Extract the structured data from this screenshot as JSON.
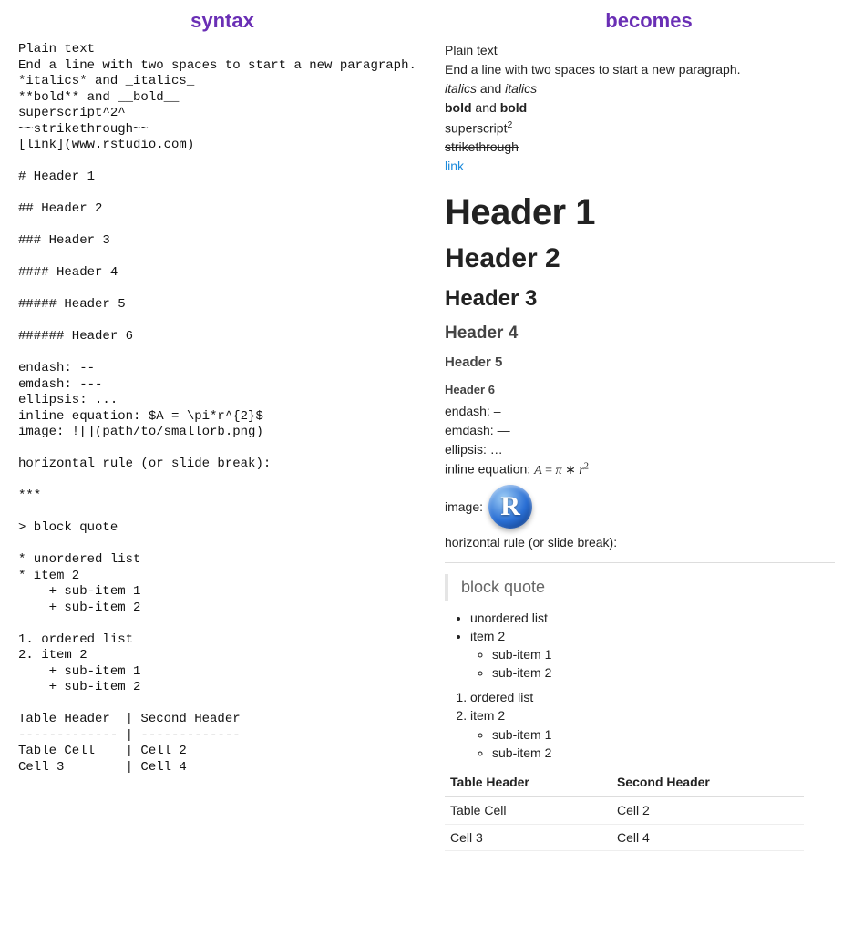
{
  "headers": {
    "syntax": "syntax",
    "becomes": "becomes"
  },
  "syntax_block": "Plain text\nEnd a line with two spaces to start a new paragraph.\n*italics* and _italics_\n**bold** and __bold__\nsuperscript^2^\n~~strikethrough~~\n[link](www.rstudio.com)\n\n# Header 1\n\n## Header 2\n\n### Header 3\n\n#### Header 4\n\n##### Header 5\n\n###### Header 6\n\nendash: --\nemdash: ---\nellipsis: ...\ninline equation: $A = \\pi*r^{2}$\nimage: ![](path/to/smallorb.png)\n\nhorizontal rule (or slide break):\n\n***\n\n> block quote\n\n* unordered list\n* item 2\n    + sub-item 1\n    + sub-item 2\n\n1. ordered list\n2. item 2\n    + sub-item 1\n    + sub-item 2\n\nTable Header  | Second Header\n------------- | -------------\nTable Cell    | Cell 2\nCell 3        | Cell 4",
  "rendered": {
    "plain1": "Plain text",
    "plain2": "End a line with two spaces to start a new paragraph.",
    "italics_word": "italics",
    "and": " and ",
    "bold_word": "bold",
    "superscript_label": "superscript",
    "superscript_exp": "2",
    "strikethrough": "strikethrough",
    "link_text": "link",
    "h1": "Header 1",
    "h2": "Header 2",
    "h3": "Header 3",
    "h4": "Header 4",
    "h5": "Header 5",
    "h6": "Header 6",
    "endash_label": "endash: ",
    "endash_char": "–",
    "emdash_label": "emdash: ",
    "emdash_char": "—",
    "ellipsis_label": "ellipsis: ",
    "ellipsis_char": "…",
    "eq_label": "inline equation: ",
    "eq_A": "A",
    "eq_eq": " = ",
    "eq_pi": "π",
    "eq_star": " ∗ ",
    "eq_r": "r",
    "eq_exp": "2",
    "image_label": "image: ",
    "r_letter": "R",
    "hr_label": "horizontal rule (or slide break):",
    "blockquote": "block quote",
    "ul": [
      "unordered list",
      "item 2"
    ],
    "ul_sub": [
      "sub-item 1",
      "sub-item 2"
    ],
    "ol": [
      "ordered list",
      "item 2"
    ],
    "ol_sub": [
      "sub-item 1",
      "sub-item 2"
    ],
    "table": {
      "headers": [
        "Table Header",
        "Second Header"
      ],
      "rows": [
        [
          "Table Cell",
          "Cell 2"
        ],
        [
          "Cell 3",
          "Cell 4"
        ]
      ]
    }
  }
}
